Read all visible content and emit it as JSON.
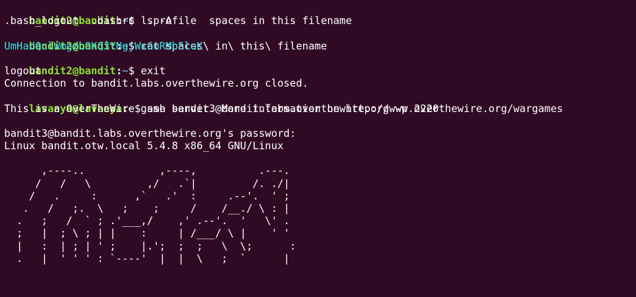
{
  "colors": {
    "background": "#300a24",
    "prompt_user": "#8ae234",
    "prompt_path": "#729fcf",
    "output_text": "#ffffff",
    "highlight_text": "#34e2e2"
  },
  "lines": [
    {
      "kind": "prompt",
      "user": "bandit2@bandit",
      "sep": ":",
      "path": "~",
      "dollar": "$ ",
      "cmd": "ls -A"
    },
    {
      "kind": "output",
      "text": ".bash_logout  .bashrc  .profile  spaces in this filename"
    },
    {
      "kind": "prompt",
      "user": "bandit2@bandit",
      "sep": ":",
      "path": "~",
      "dollar": "$ ",
      "cmd": "cat spaces\\ in\\ this\\ filename"
    },
    {
      "kind": "highlight",
      "text": "UmHadQclWmgdLOKQ3YNgjWxGoRMb5luK"
    },
    {
      "kind": "prompt",
      "user": "bandit2@bandit",
      "sep": ":",
      "path": "~",
      "dollar": "$ ",
      "cmd": "exit"
    },
    {
      "kind": "output",
      "text": "logout"
    },
    {
      "kind": "output",
      "text": "Connection to bandit.labs.overthewire.org closed."
    },
    {
      "kind": "prompt",
      "user": "lavanya@lavanya",
      "sep": ":",
      "path": "~",
      "dollar": "$ ",
      "cmd": "ssh bandit3@bandit.labs.overthewire.org -p 2220"
    },
    {
      "kind": "output",
      "text": "This is a OverTheWire game server. More information on http://www.overthewire.org/wargames"
    },
    {
      "kind": "output",
      "text": ""
    },
    {
      "kind": "output",
      "text": "bandit3@bandit.labs.overthewire.org's password:"
    },
    {
      "kind": "output",
      "text": "Linux bandit.otw.local 5.4.8 x86_64 GNU/Linux"
    },
    {
      "kind": "output",
      "text": ""
    },
    {
      "kind": "art",
      "text": "      ,----..            ,----,          .---."
    },
    {
      "kind": "art",
      "text": "     /   /   \\         ,/   .`|         /. ./|"
    },
    {
      "kind": "art",
      "text": "    /   .     :      ,`   .'  :     .--'.  ' ;"
    },
    {
      "kind": "art",
      "text": "   .   /   ;.  \\   ;    ;     /    /__./ \\ : |"
    },
    {
      "kind": "art",
      "text": "  .   ;   /  ` ; .'___,/    ,' .--'.  '   \\' ."
    },
    {
      "kind": "art",
      "text": "  ;   |  ; \\ ; | |    :     | /___/ \\ |    ' '"
    },
    {
      "kind": "art",
      "text": "  |   :  | ; | ' ;    |.';  ;  ;   \\  \\;      :"
    },
    {
      "kind": "art",
      "text": "  .   |  ' ' ' : `----'  |  |  \\   ;  `      |"
    }
  ]
}
